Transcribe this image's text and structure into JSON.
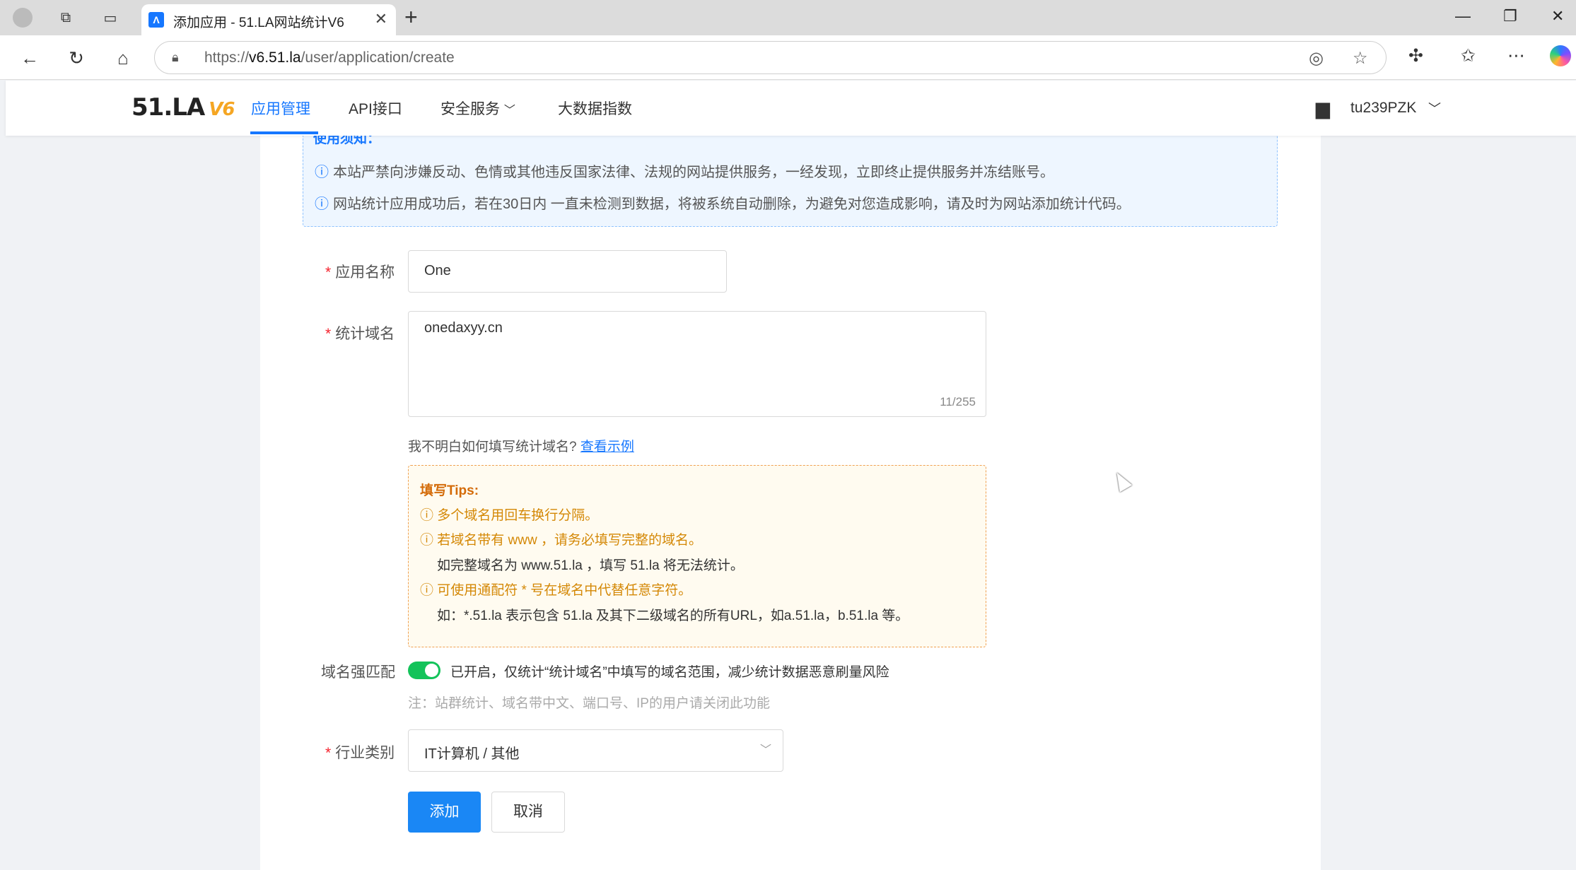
{
  "browser": {
    "tab_title": "添加应用 - 51.LA网站统计V6",
    "url_prefix": "https://",
    "url_domain": "v6.51.la",
    "url_path": "/user/application/create"
  },
  "site": {
    "logo_text": "51.LA",
    "logo_badge": "V6",
    "nav": [
      {
        "label": "应用管理",
        "active": true
      },
      {
        "label": "API接口",
        "active": false
      },
      {
        "label": "安全服务",
        "active": false,
        "dropdown": true
      },
      {
        "label": "大数据指数",
        "active": false
      }
    ],
    "username": "tu239PZK"
  },
  "notice": {
    "title": "使用须知：",
    "lines": [
      "本站严禁向涉嫌反动、色情或其他违反国家法律、法规的网站提供服务，一经发现，立即终止提供服务并冻结账号。",
      "网站统计应用成功后，若在30日内 一直未检测到数据，将被系统自动删除，为避免对您造成影响，请及时为网站添加统计代码。"
    ]
  },
  "form": {
    "app_name_label": "应用名称",
    "app_name_value": "One",
    "domain_label": "统计域名",
    "domain_value": "onedaxyy.cn",
    "domain_counter": "11/255",
    "help_text": "我不明白如何填写统计域名?",
    "help_link": "查看示例",
    "tips": {
      "title": "填写Tips:",
      "line1": "多个域名用回车换行分隔。",
      "line2": "若域名带有 www ，请务必填写完整的域名。",
      "line3": "如完整域名为 www.51.la ，填写 51.la 将无法统计。",
      "line4": "可使用通配符 * 号在域名中代替任意字符。",
      "line5": "如：*.51.la 表示包含 51.la 及其下二级域名的所有URL，如a.51.la，b.51.la 等。"
    },
    "strict_label": "域名强匹配",
    "strict_on": true,
    "strict_text": "已开启，仅统计“统计域名”中填写的域名范围，减少统计数据恶意刷量风险",
    "strict_note": "注：站群统计、域名带中文、端口号、IP的用户请关闭此功能",
    "industry_label": "行业类别",
    "industry_value": "IT计算机 / 其他",
    "submit_label": "添加",
    "cancel_label": "取消"
  },
  "colors": {
    "primary": "#1677ff",
    "switch_on": "#13c35a",
    "tip_warn": "#d48806",
    "required": "#f5222d"
  }
}
